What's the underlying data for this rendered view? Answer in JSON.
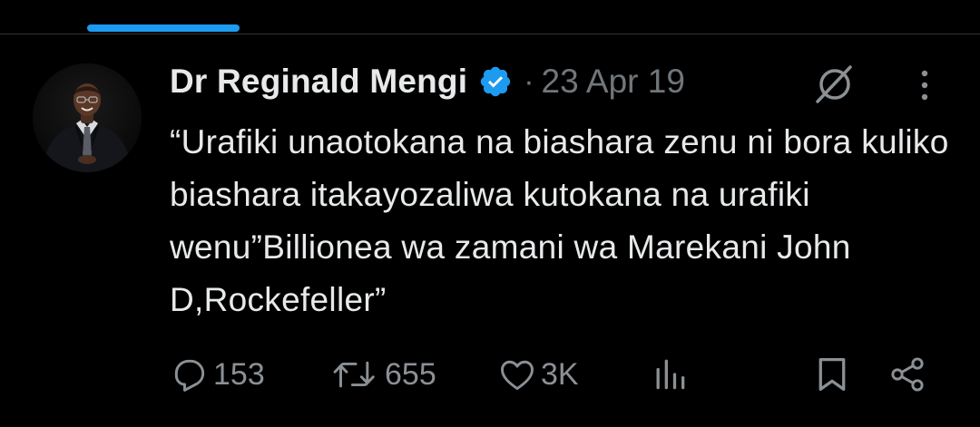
{
  "tabs": {
    "active_indicator_color": "#1d9bf0"
  },
  "post": {
    "author": {
      "name": "Dr Reginald Mengi",
      "verified": true,
      "verified_color": "#1d9bf0",
      "avatar_icon": "avatar-photo"
    },
    "separator": "·",
    "date": "23 Apr 19",
    "text": "“Urafiki unaotokana na biashara zenu ni bora kuliko biashara itakayozaliwa kutokana na urafiki wenu”Billionea wa zamani wa Marekani John D,Rockefeller”",
    "header_icons": [
      "grok-icon",
      "more-vertical-icon"
    ]
  },
  "actions": {
    "reply": {
      "icon": "reply-icon",
      "count": "153"
    },
    "repost": {
      "icon": "repost-icon",
      "count": "655"
    },
    "like": {
      "icon": "heart-icon",
      "count": "3K"
    },
    "views": {
      "icon": "views-icon"
    },
    "bookmark": {
      "icon": "bookmark-icon"
    },
    "share": {
      "icon": "share-icon"
    }
  },
  "colors": {
    "background": "#000000",
    "text_primary": "#e7e9ea",
    "text_secondary": "#71767b",
    "divider": "#2f3336"
  }
}
